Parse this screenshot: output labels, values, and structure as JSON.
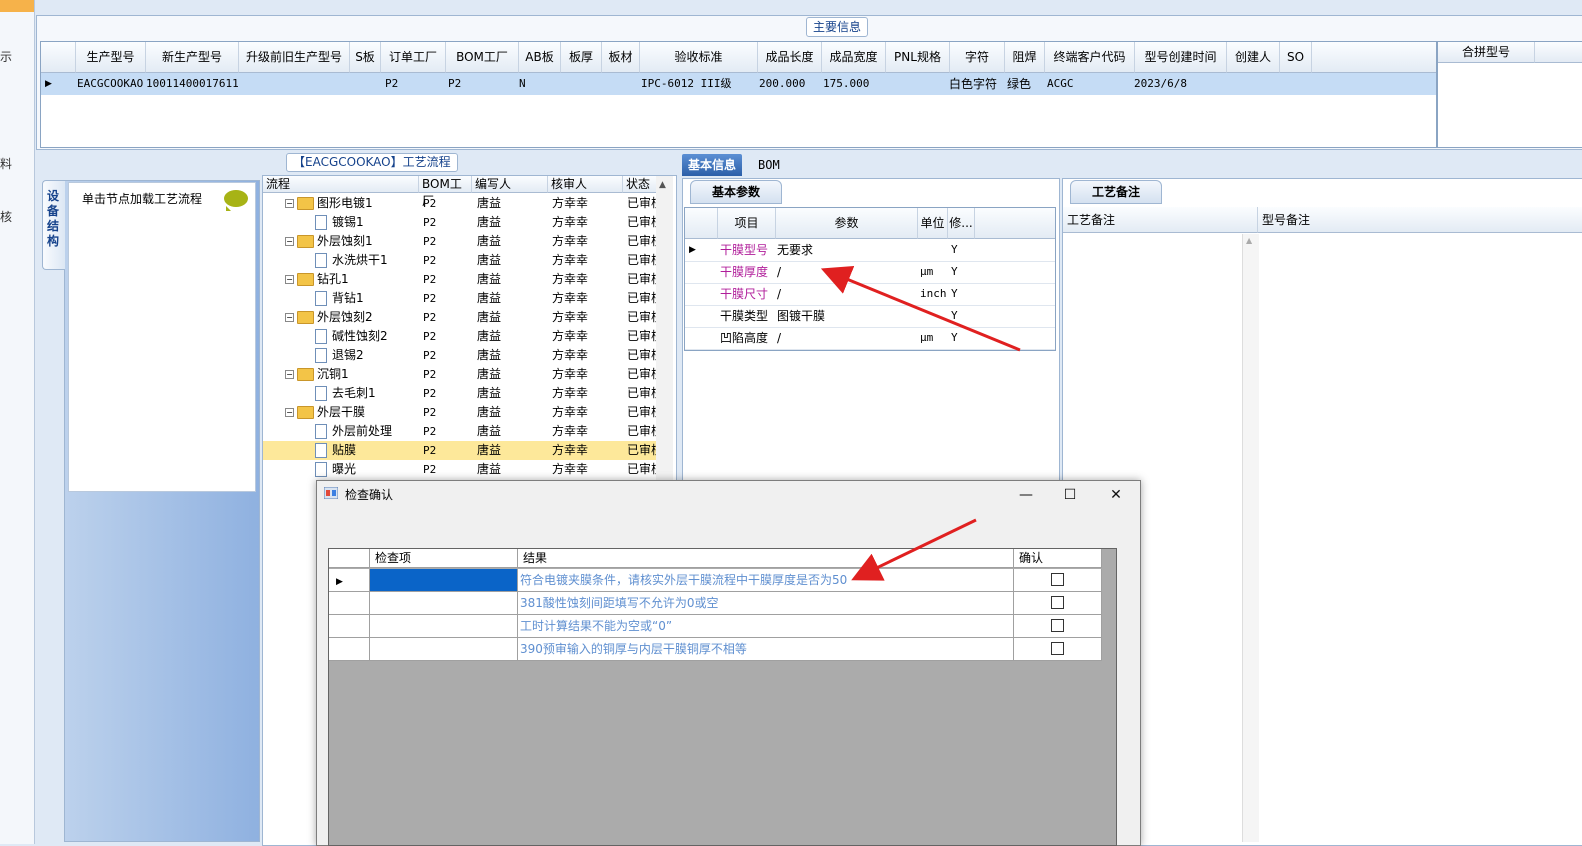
{
  "left_strip": {
    "labels": [
      "示",
      "料",
      "核"
    ]
  },
  "top_panel": {
    "title": "主要信息",
    "columns": [
      "生产型号",
      "新生产型号",
      "升级前旧生产型号",
      "S板",
      "订单工厂",
      "BOM工厂",
      "AB板",
      "板厚",
      "板材",
      "验收标准",
      "成品长度",
      "成品宽度",
      "PNL规格",
      "字符",
      "阻焊",
      "终端客户代码",
      "型号创建时间",
      "创建人",
      "SO"
    ],
    "row": {
      "生产型号": "EACGCOOKAO",
      "新生产型号": "10011400017611",
      "订单工厂": "P2",
      "BOM工厂": "P2",
      "AB板": "N",
      "验收标准": "IPC-6012 III级",
      "成品长度": "200.000",
      "成品宽度": "175.000",
      "字符": "白色字符",
      "阻焊": "绿色",
      "终端客户代码": "ACGC",
      "型号创建时间": "2023/6/8"
    },
    "merge_title": "合拼型号"
  },
  "process_panel": {
    "title": "【EACGCOOKAO】工艺流程",
    "side_tab": "设备结构",
    "load_hint": "单击节点加载工艺流程",
    "columns": [
      "流程",
      "BOM工厂",
      "编写人",
      "核审人",
      "状态"
    ],
    "rows": [
      {
        "name": "图形电镀1",
        "level": 0,
        "factory": "P2",
        "writer": "唐益",
        "reviewer": "方幸幸",
        "status": "已审核"
      },
      {
        "name": "镀锡1",
        "level": 1,
        "factory": "P2",
        "writer": "唐益",
        "reviewer": "方幸幸",
        "status": "已审核"
      },
      {
        "name": "外层蚀刻1",
        "level": 0,
        "factory": "P2",
        "writer": "唐益",
        "reviewer": "方幸幸",
        "status": "已审核"
      },
      {
        "name": "水洗烘干1",
        "level": 1,
        "factory": "P2",
        "writer": "唐益",
        "reviewer": "方幸幸",
        "status": "已审核"
      },
      {
        "name": "钻孔1",
        "level": 0,
        "factory": "P2",
        "writer": "唐益",
        "reviewer": "方幸幸",
        "status": "已审核"
      },
      {
        "name": "背钻1",
        "level": 1,
        "factory": "P2",
        "writer": "唐益",
        "reviewer": "方幸幸",
        "status": "已审核"
      },
      {
        "name": "外层蚀刻2",
        "level": 0,
        "factory": "P2",
        "writer": "唐益",
        "reviewer": "方幸幸",
        "status": "已审核"
      },
      {
        "name": "碱性蚀刻2",
        "level": 1,
        "factory": "P2",
        "writer": "唐益",
        "reviewer": "方幸幸",
        "status": "已审核"
      },
      {
        "name": "退锡2",
        "level": 1,
        "factory": "P2",
        "writer": "唐益",
        "reviewer": "方幸幸",
        "status": "已审核"
      },
      {
        "name": "沉铜1",
        "level": 0,
        "factory": "P2",
        "writer": "唐益",
        "reviewer": "方幸幸",
        "status": "已审核"
      },
      {
        "name": "去毛刺1",
        "level": 1,
        "factory": "P2",
        "writer": "唐益",
        "reviewer": "方幸幸",
        "status": "已审核"
      },
      {
        "name": "外层干膜",
        "level": 0,
        "factory": "P2",
        "writer": "唐益",
        "reviewer": "方幸幸",
        "status": "已审核"
      },
      {
        "name": "外层前处理",
        "level": 1,
        "factory": "P2",
        "writer": "唐益",
        "reviewer": "方幸幸",
        "status": "已审核"
      },
      {
        "name": "贴膜",
        "level": 1,
        "factory": "P2",
        "writer": "唐益",
        "reviewer": "方幸幸",
        "status": "已审核",
        "selected": true
      },
      {
        "name": "曝光",
        "level": 1,
        "factory": "P2",
        "writer": "唐益",
        "reviewer": "方幸幸",
        "status": "已审核"
      }
    ]
  },
  "basic_info": {
    "tabs": [
      "基本信息",
      "BOM"
    ],
    "section_title": "基本参数",
    "columns": [
      "项目",
      "参数",
      "单位",
      "修..."
    ],
    "rows": [
      {
        "item": "干膜型号",
        "param": "无要求",
        "unit": "",
        "mod": "Y",
        "highlight": true
      },
      {
        "item": "干膜厚度",
        "param": "/",
        "unit": "μm",
        "mod": "Y",
        "highlight": true
      },
      {
        "item": "干膜尺寸",
        "param": "/",
        "unit": "inch",
        "mod": "Y",
        "highlight": true
      },
      {
        "item": "干膜类型",
        "param": "图镀干膜",
        "unit": "",
        "mod": "Y",
        "highlight": false
      },
      {
        "item": "凹陷高度",
        "param": "/",
        "unit": "μm",
        "mod": "Y",
        "highlight": false
      }
    ]
  },
  "notes": {
    "section_title": "工艺备注",
    "columns": [
      "工艺备注",
      "型号备注"
    ]
  },
  "dialog": {
    "title": "检查确认",
    "columns": [
      "检查项",
      "结果",
      "确认"
    ],
    "rows": [
      {
        "result": "符合电镀夹膜条件，请核实外层干膜流程中干膜厚度是否为50",
        "checked": false
      },
      {
        "result": "381酸性蚀刻间距填写不允许为0或空",
        "checked": false
      },
      {
        "result": "工时计算结果不能为空或“0”",
        "checked": false
      },
      {
        "result": "390预审输入的铜厚与内层干膜铜厚不相等",
        "checked": false
      }
    ]
  },
  "colors": {
    "accent": "#2c5fa8",
    "selection": "#0a64c8",
    "annotation_arrow": "#e02020",
    "link_text": "#5f8fd0"
  }
}
